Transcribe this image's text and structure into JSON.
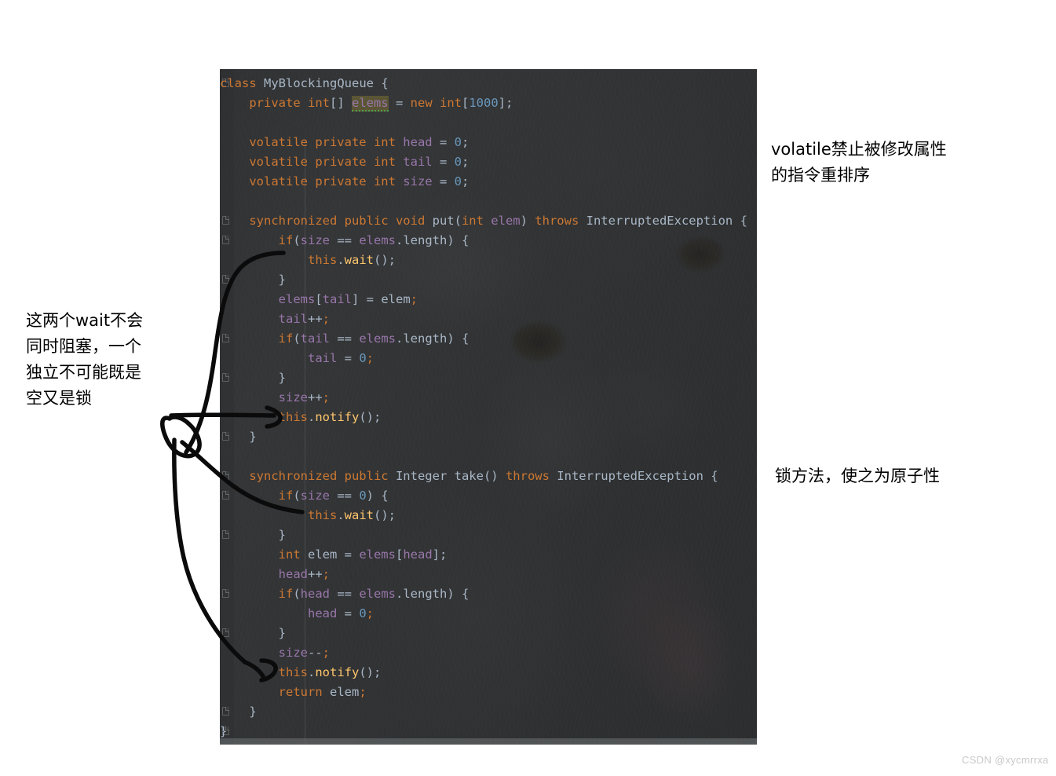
{
  "editor": {
    "language": "java",
    "theme": "darcula",
    "background_image": "cat-photo",
    "highlighted_token": "elems",
    "colors": {
      "panel_background": "#2f3133",
      "keyword": "#cc7832",
      "field": "#9876aa",
      "number": "#6897bb",
      "identifier": "#a9b7c6",
      "method_call": "#ffc66d",
      "warning_highlight": "#5a5534",
      "warning_underline": "#51a151"
    },
    "code_lines": [
      [
        {
          "t": "class ",
          "c": "kw"
        },
        {
          "t": "MyBlockingQueue ",
          "c": "cls"
        },
        {
          "t": "{",
          "c": "brace"
        }
      ],
      [
        {
          "t": "    ",
          "c": "plain"
        },
        {
          "t": "private ",
          "c": "kw"
        },
        {
          "t": "int",
          "c": "kw"
        },
        {
          "t": "[] ",
          "c": "plain"
        },
        {
          "t": "elems",
          "c": "warnhl"
        },
        {
          "t": " = ",
          "c": "plain"
        },
        {
          "t": "new ",
          "c": "kw"
        },
        {
          "t": "int",
          "c": "kw"
        },
        {
          "t": "[",
          "c": "plain"
        },
        {
          "t": "1000",
          "c": "num"
        },
        {
          "t": "];",
          "c": "plain"
        }
      ],
      [],
      [
        {
          "t": "    ",
          "c": "plain"
        },
        {
          "t": "volatile private ",
          "c": "kw"
        },
        {
          "t": "int ",
          "c": "kw"
        },
        {
          "t": "head",
          "c": "field"
        },
        {
          "t": " = ",
          "c": "plain"
        },
        {
          "t": "0",
          "c": "num"
        },
        {
          "t": ";",
          "c": "plain"
        }
      ],
      [
        {
          "t": "    ",
          "c": "plain"
        },
        {
          "t": "volatile private ",
          "c": "kw"
        },
        {
          "t": "int ",
          "c": "kw"
        },
        {
          "t": "tail",
          "c": "field"
        },
        {
          "t": " = ",
          "c": "plain"
        },
        {
          "t": "0",
          "c": "num"
        },
        {
          "t": ";",
          "c": "plain"
        }
      ],
      [
        {
          "t": "    ",
          "c": "plain"
        },
        {
          "t": "volatile private ",
          "c": "kw"
        },
        {
          "t": "int ",
          "c": "kw"
        },
        {
          "t": "size",
          "c": "field"
        },
        {
          "t": " = ",
          "c": "plain"
        },
        {
          "t": "0",
          "c": "num"
        },
        {
          "t": ";",
          "c": "plain"
        }
      ],
      [],
      [
        {
          "t": "    ",
          "c": "plain"
        },
        {
          "t": "synchronized public void ",
          "c": "kw"
        },
        {
          "t": "put",
          "c": "method"
        },
        {
          "t": "(",
          "c": "plain"
        },
        {
          "t": "int ",
          "c": "kw"
        },
        {
          "t": "elem",
          "c": "field"
        },
        {
          "t": ") ",
          "c": "plain"
        },
        {
          "t": "throws ",
          "c": "kw"
        },
        {
          "t": "InterruptedException ",
          "c": "cls"
        },
        {
          "t": "{",
          "c": "brace"
        }
      ],
      [
        {
          "t": "        ",
          "c": "plain"
        },
        {
          "t": "if",
          "c": "kw"
        },
        {
          "t": "(",
          "c": "plain"
        },
        {
          "t": "size",
          "c": "field"
        },
        {
          "t": " == ",
          "c": "plain"
        },
        {
          "t": "elems",
          "c": "field"
        },
        {
          "t": ".length) {",
          "c": "plain"
        }
      ],
      [
        {
          "t": "            ",
          "c": "plain"
        },
        {
          "t": "this",
          "c": "kw"
        },
        {
          "t": ".",
          "c": "plain"
        },
        {
          "t": "wait",
          "c": "mcall"
        },
        {
          "t": "();",
          "c": "plain"
        }
      ],
      [
        {
          "t": "        }",
          "c": "brace"
        }
      ],
      [
        {
          "t": "        ",
          "c": "plain"
        },
        {
          "t": "elems",
          "c": "field"
        },
        {
          "t": "[",
          "c": "plain"
        },
        {
          "t": "tail",
          "c": "field"
        },
        {
          "t": "] = ",
          "c": "plain"
        },
        {
          "t": "elem",
          "c": "local"
        },
        {
          "t": ";",
          "c": "semi"
        }
      ],
      [
        {
          "t": "        ",
          "c": "plain"
        },
        {
          "t": "tail",
          "c": "field"
        },
        {
          "t": "++",
          "c": "plain"
        },
        {
          "t": ";",
          "c": "semi"
        }
      ],
      [
        {
          "t": "        ",
          "c": "plain"
        },
        {
          "t": "if",
          "c": "kw"
        },
        {
          "t": "(",
          "c": "plain"
        },
        {
          "t": "tail",
          "c": "field"
        },
        {
          "t": " == ",
          "c": "plain"
        },
        {
          "t": "elems",
          "c": "field"
        },
        {
          "t": ".length) {",
          "c": "plain"
        }
      ],
      [
        {
          "t": "            ",
          "c": "plain"
        },
        {
          "t": "tail",
          "c": "field"
        },
        {
          "t": " = ",
          "c": "plain"
        },
        {
          "t": "0",
          "c": "num"
        },
        {
          "t": ";",
          "c": "semi"
        }
      ],
      [
        {
          "t": "        }",
          "c": "brace"
        }
      ],
      [
        {
          "t": "        ",
          "c": "plain"
        },
        {
          "t": "size",
          "c": "field"
        },
        {
          "t": "++",
          "c": "plain"
        },
        {
          "t": ";",
          "c": "semi"
        }
      ],
      [
        {
          "t": "        ",
          "c": "plain"
        },
        {
          "t": "this",
          "c": "kw"
        },
        {
          "t": ".",
          "c": "plain"
        },
        {
          "t": "notify",
          "c": "mcall"
        },
        {
          "t": "();",
          "c": "plain"
        }
      ],
      [
        {
          "t": "    }",
          "c": "brace"
        }
      ],
      [],
      [
        {
          "t": "    ",
          "c": "plain"
        },
        {
          "t": "synchronized public ",
          "c": "kw"
        },
        {
          "t": "Integer ",
          "c": "cls"
        },
        {
          "t": "take",
          "c": "method"
        },
        {
          "t": "() ",
          "c": "plain"
        },
        {
          "t": "throws ",
          "c": "kw"
        },
        {
          "t": "InterruptedException ",
          "c": "cls"
        },
        {
          "t": "{",
          "c": "brace"
        }
      ],
      [
        {
          "t": "        ",
          "c": "plain"
        },
        {
          "t": "if",
          "c": "kw"
        },
        {
          "t": "(",
          "c": "plain"
        },
        {
          "t": "size",
          "c": "field"
        },
        {
          "t": " == ",
          "c": "plain"
        },
        {
          "t": "0",
          "c": "num"
        },
        {
          "t": ") {",
          "c": "plain"
        }
      ],
      [
        {
          "t": "            ",
          "c": "plain"
        },
        {
          "t": "this",
          "c": "kw"
        },
        {
          "t": ".",
          "c": "plain"
        },
        {
          "t": "wait",
          "c": "mcall"
        },
        {
          "t": "();",
          "c": "plain"
        }
      ],
      [
        {
          "t": "        }",
          "c": "brace"
        }
      ],
      [
        {
          "t": "        ",
          "c": "plain"
        },
        {
          "t": "int ",
          "c": "kw"
        },
        {
          "t": "elem",
          "c": "local"
        },
        {
          "t": " = ",
          "c": "plain"
        },
        {
          "t": "elems",
          "c": "field"
        },
        {
          "t": "[",
          "c": "plain"
        },
        {
          "t": "head",
          "c": "field"
        },
        {
          "t": "];",
          "c": "plain"
        }
      ],
      [
        {
          "t": "        ",
          "c": "plain"
        },
        {
          "t": "head",
          "c": "field"
        },
        {
          "t": "++",
          "c": "plain"
        },
        {
          "t": ";",
          "c": "semi"
        }
      ],
      [
        {
          "t": "        ",
          "c": "plain"
        },
        {
          "t": "if",
          "c": "kw"
        },
        {
          "t": "(",
          "c": "plain"
        },
        {
          "t": "head",
          "c": "field"
        },
        {
          "t": " == ",
          "c": "plain"
        },
        {
          "t": "elems",
          "c": "field"
        },
        {
          "t": ".length) {",
          "c": "plain"
        }
      ],
      [
        {
          "t": "            ",
          "c": "plain"
        },
        {
          "t": "head",
          "c": "field"
        },
        {
          "t": " = ",
          "c": "plain"
        },
        {
          "t": "0",
          "c": "num"
        },
        {
          "t": ";",
          "c": "semi"
        }
      ],
      [
        {
          "t": "        }",
          "c": "brace"
        }
      ],
      [
        {
          "t": "        ",
          "c": "plain"
        },
        {
          "t": "size",
          "c": "field"
        },
        {
          "t": "--",
          "c": "plain"
        },
        {
          "t": ";",
          "c": "semi"
        }
      ],
      [
        {
          "t": "        ",
          "c": "plain"
        },
        {
          "t": "this",
          "c": "kw"
        },
        {
          "t": ".",
          "c": "plain"
        },
        {
          "t": "notify",
          "c": "mcall"
        },
        {
          "t": "();",
          "c": "plain"
        }
      ],
      [
        {
          "t": "        ",
          "c": "plain"
        },
        {
          "t": "return ",
          "c": "kw"
        },
        {
          "t": "elem",
          "c": "local"
        },
        {
          "t": ";",
          "c": "semi"
        }
      ],
      [
        {
          "t": "    }",
          "c": "brace"
        }
      ],
      [
        {
          "t": "}",
          "c": "brace"
        }
      ]
    ]
  },
  "annotations": {
    "left_wait": "这两个wait不会\n同时阻塞，一个\n独立不可能既是\n空又是锁",
    "volatile_note": "volatile禁止被修改属性\n的指令重排序",
    "lock_note": "锁方法，使之为原子性"
  },
  "watermark": "CSDN @xycmrrxa"
}
